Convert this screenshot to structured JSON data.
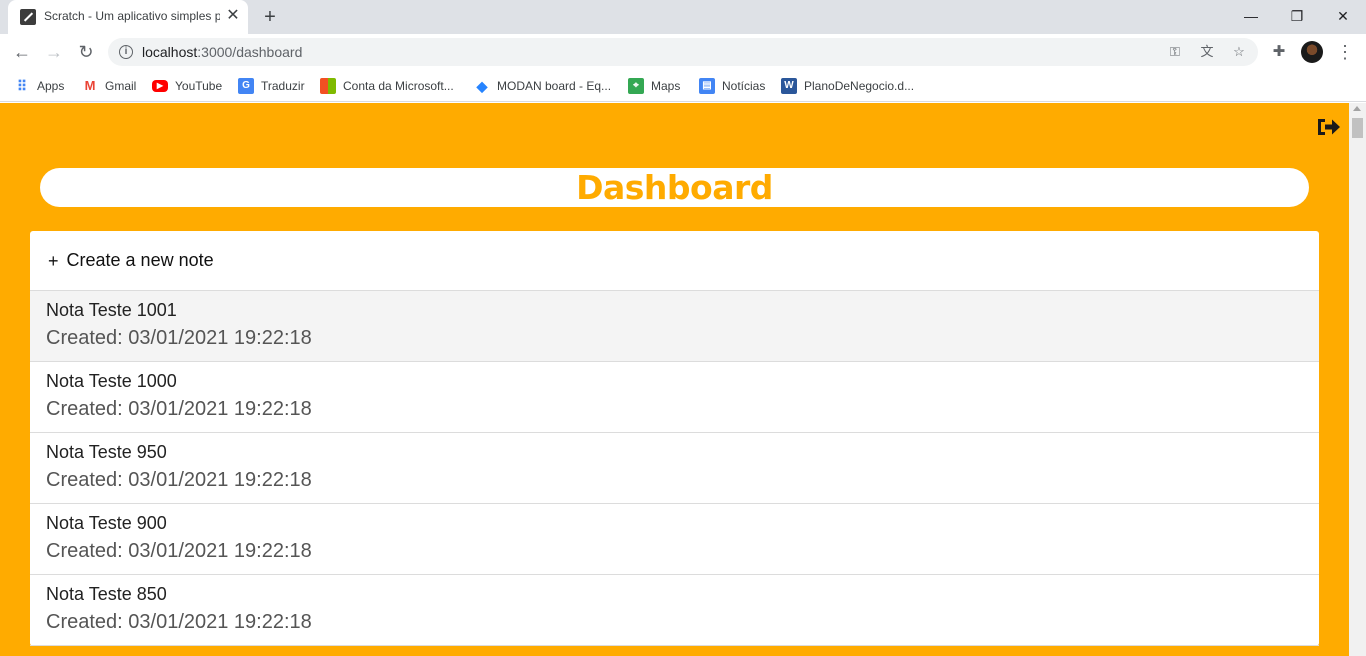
{
  "browser": {
    "tab_title": "Scratch - Um aplicativo simples p",
    "tab_close": "✕",
    "new_tab": "+",
    "window_controls": {
      "minimize": "—",
      "restore": "❐",
      "close": "✕"
    },
    "url_host": "localhost",
    "url_path": ":3000/dashboard",
    "bookmarks": [
      {
        "label": "Apps",
        "icon": "apps-grid-icon",
        "color": "#4285f4"
      },
      {
        "label": "Gmail",
        "icon": "gmail-icon",
        "color": "#ea4335"
      },
      {
        "label": "YouTube",
        "icon": "youtube-icon",
        "color": "#ff0000"
      },
      {
        "label": "Traduzir",
        "icon": "translate-icon",
        "color": "#4285f4"
      },
      {
        "label": "Conta da Microsoft...",
        "icon": "microsoft-icon",
        "color": "#f25022"
      },
      {
        "label": "MODAN board - Eq...",
        "icon": "jira-icon",
        "color": "#2684ff"
      },
      {
        "label": "Maps",
        "icon": "maps-icon",
        "color": "#34a853"
      },
      {
        "label": "Notícias",
        "icon": "news-icon",
        "color": "#4285f4"
      },
      {
        "label": "PlanoDeNegocio.d...",
        "icon": "word-icon",
        "color": "#2b579a"
      }
    ]
  },
  "app": {
    "accent_color": "#ffab00",
    "header_title": "Dashboard",
    "create_label": "Create a new note",
    "create_icon": "+",
    "notes": [
      {
        "title": "Nota Teste 1001",
        "created": "Created: 03/01/2021 19:22:18"
      },
      {
        "title": "Nota Teste 1000",
        "created": "Created: 03/01/2021 19:22:18"
      },
      {
        "title": "Nota Teste 950",
        "created": "Created: 03/01/2021 19:22:18"
      },
      {
        "title": "Nota Teste 900",
        "created": "Created: 03/01/2021 19:22:18"
      },
      {
        "title": "Nota Teste 850",
        "created": "Created: 03/01/2021 19:22:18"
      }
    ]
  }
}
